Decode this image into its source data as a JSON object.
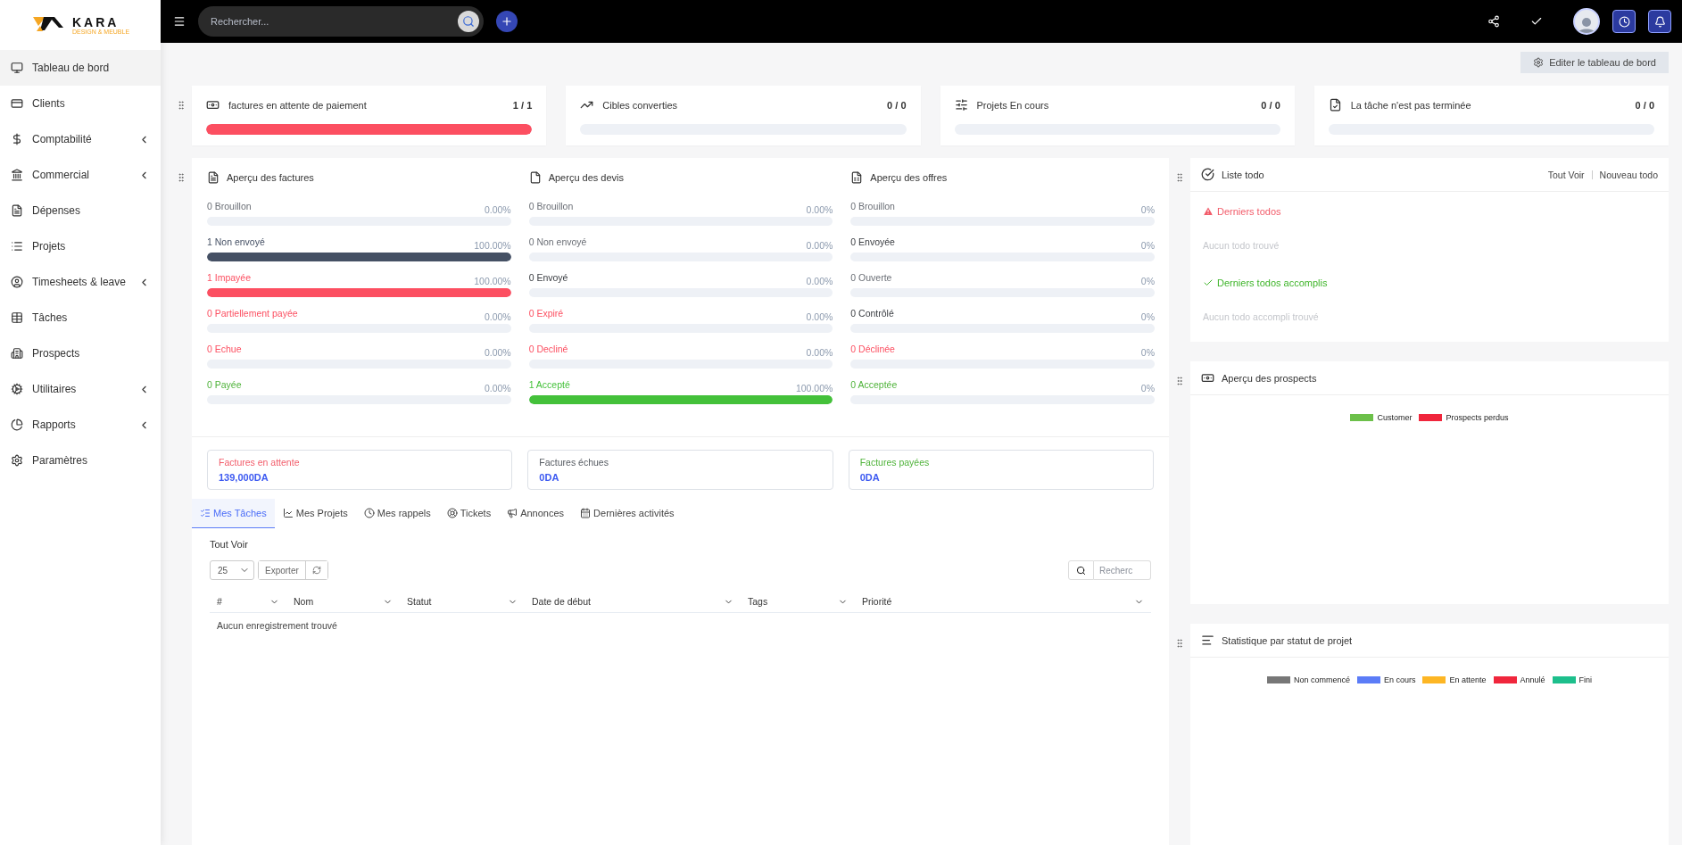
{
  "logo": {
    "name": "KARA",
    "tagline": "DESIGN & MEUBLE"
  },
  "sidebar": {
    "items": [
      {
        "label": "Tableau de bord",
        "selected": true,
        "expandable": false
      },
      {
        "label": "Clients",
        "selected": false,
        "expandable": false
      },
      {
        "label": "Comptabilité",
        "selected": false,
        "expandable": true
      },
      {
        "label": "Commercial",
        "selected": false,
        "expandable": true
      },
      {
        "label": "Dépenses",
        "selected": false,
        "expandable": false
      },
      {
        "label": "Projets",
        "selected": false,
        "expandable": false
      },
      {
        "label": "Timesheets & leave",
        "selected": false,
        "expandable": true
      },
      {
        "label": "Tâches",
        "selected": false,
        "expandable": false
      },
      {
        "label": "Prospects",
        "selected": false,
        "expandable": false
      },
      {
        "label": "Utilitaires",
        "selected": false,
        "expandable": true
      },
      {
        "label": "Rapports",
        "selected": false,
        "expandable": true
      },
      {
        "label": "Paramètres",
        "selected": false,
        "expandable": false
      }
    ]
  },
  "topbar": {
    "search": {
      "placeholder": "Rechercher..."
    }
  },
  "edit_button": "Editer le tableau de bord",
  "stat_cards": [
    {
      "title": "factures en attente de paiement",
      "value": "1 / 1",
      "level": 1
    },
    {
      "title": "Cibles converties",
      "value": "0 / 0",
      "level": 0
    },
    {
      "title": "Projets En cours",
      "value": "0 / 0",
      "level": 0
    },
    {
      "title": "La tâche n'est pas terminée",
      "value": "0 / 0",
      "level": 0
    }
  ],
  "overviews": [
    {
      "title": "Aperçu des factures",
      "rows": [
        {
          "label": "0 Brouillon",
          "percent": "0.00%",
          "level": 0,
          "color": "#6b6f76"
        },
        {
          "label": "1 Non envoyé",
          "percent": "100.00%",
          "level": 1,
          "color": "#455064"
        },
        {
          "label": "1 Impayée",
          "percent": "100.00%",
          "level": 1,
          "color": "#fc4f61"
        },
        {
          "label": "0 Partiellement payée",
          "percent": "0.00%",
          "level": 0,
          "color": "#fc4f61"
        },
        {
          "label": "0 Echue",
          "percent": "0.00%",
          "level": 0,
          "color": "#fc4f61"
        },
        {
          "label": "0 Payée",
          "percent": "0.00%",
          "level": 0,
          "color": "#4fb33a"
        }
      ]
    },
    {
      "title": "Aperçu des devis",
      "rows": [
        {
          "label": "0 Brouillon",
          "percent": "0.00%",
          "level": 0,
          "color": "#6b6f76"
        },
        {
          "label": "0 Non envoyé",
          "percent": "0.00%",
          "level": 0,
          "color": "#6b6f76"
        },
        {
          "label": "0 Envoyé",
          "percent": "0.00%",
          "level": 0,
          "color": "#3a3d42"
        },
        {
          "label": "0 Expiré",
          "percent": "0.00%",
          "level": 0,
          "color": "#fc4f61"
        },
        {
          "label": "0 Decliné",
          "percent": "0.00%",
          "level": 0,
          "color": "#fc4f61"
        },
        {
          "label": "1 Accepté",
          "percent": "100.00%",
          "level": 1,
          "color": "#44c13a"
        }
      ]
    },
    {
      "title": "Aperçu des offres",
      "rows": [
        {
          "label": "0 Brouillon",
          "percent": "0%",
          "level": 0,
          "color": "#6b6f76"
        },
        {
          "label": "0 Envoyée",
          "percent": "0%",
          "level": 0,
          "color": "#3a3d42"
        },
        {
          "label": "0 Ouverte",
          "percent": "0%",
          "level": 0,
          "color": "#6b6f76"
        },
        {
          "label": "0 Contrôlé",
          "percent": "0%",
          "level": 0,
          "color": "#3a3d42"
        },
        {
          "label": "0 Déclinée",
          "percent": "0%",
          "level": 0,
          "color": "#fc4f61"
        },
        {
          "label": "0 Acceptée",
          "percent": "0%",
          "level": 0,
          "color": "#4fb33a"
        }
      ]
    }
  ],
  "summaries": [
    {
      "label": "Factures en attente",
      "amount": "139,000DA",
      "color": "#f25c6a"
    },
    {
      "label": "Factures échues",
      "amount": "0DA",
      "color": "#555a61"
    },
    {
      "label": "Factures payées",
      "amount": "0DA",
      "color": "#4fb33a"
    }
  ],
  "tabs": [
    {
      "label": "Mes Tâches",
      "selected": true
    },
    {
      "label": "Mes Projets",
      "selected": false
    },
    {
      "label": "Mes rappels",
      "selected": false
    },
    {
      "label": "Tickets",
      "selected": false
    },
    {
      "label": "Annonces",
      "selected": false
    },
    {
      "label": "Dernières activités",
      "selected": false
    }
  ],
  "tasks": {
    "link": "Tout Voir",
    "page_size": "25",
    "export": "Exporter",
    "search_placeholder": "Recherc",
    "columns": [
      "#",
      "Nom",
      "Statut",
      "Date de début",
      "Tags",
      "Priorité"
    ],
    "empty": "Aucun enregistrement trouvé"
  },
  "todo": {
    "title": "Liste todo",
    "links": [
      "Tout Voir",
      "Nouveau todo"
    ],
    "sections": [
      {
        "kind": "pending",
        "heading": "Derniers todos",
        "empty": "Aucun todo trouvé"
      },
      {
        "kind": "done",
        "heading": "Derniers todos accomplis",
        "empty": "Aucun todo accompli trouvé"
      }
    ]
  },
  "prospects": {
    "title": "Aperçu des prospects",
    "legend": [
      {
        "label": "Customer",
        "color": "#6cc04a"
      },
      {
        "label": "Prospects perdus",
        "color": "#f0263c"
      }
    ]
  },
  "project_stats": {
    "title": "Statistique par statut de projet",
    "legend": [
      {
        "label": "Non commencé",
        "color": "#777777"
      },
      {
        "label": "En cours",
        "color": "#5b7cf7"
      },
      {
        "label": "En attente",
        "color": "#fdb624"
      },
      {
        "label": "Annulé",
        "color": "#f0263c"
      },
      {
        "label": "Fini",
        "color": "#1dbf8c"
      }
    ]
  }
}
